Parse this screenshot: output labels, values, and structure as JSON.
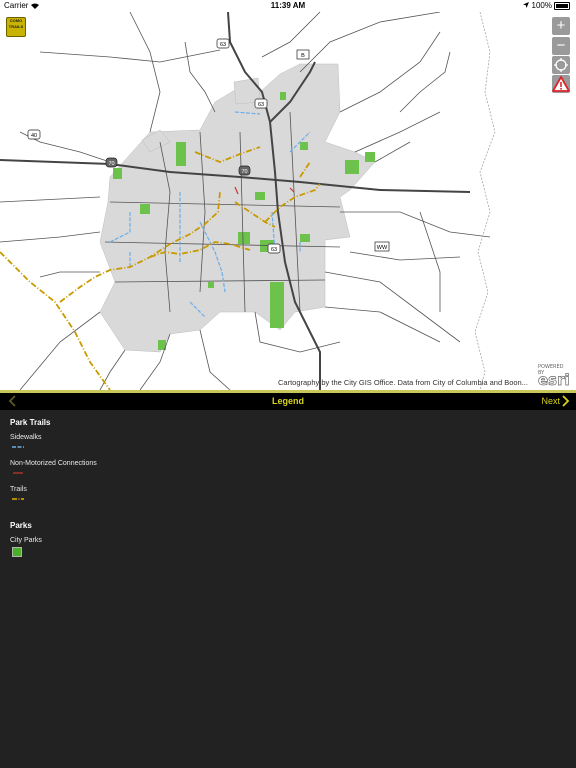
{
  "status_bar": {
    "carrier": "Carrier",
    "time": "11:39 AM",
    "battery": "100%"
  },
  "map": {
    "logo_text": "COMO TRAILS",
    "zoom_in": "+",
    "zoom_out": "−",
    "route_labels": [
      "63",
      "B",
      "63",
      "40",
      "70",
      "70",
      "63",
      "WW"
    ],
    "attribution": "Cartography by the City GIS Office. Data from City of Columbia and Boon...",
    "esri_powered": "POWERED BY",
    "esri_logo": "esri",
    "colors": {
      "city_area": "#d9d9d9",
      "parks": "#6cc24a",
      "sidewalks": "#6aaee8",
      "non_motorized": "#c0392b",
      "trails": "#c99a00",
      "roads": "#555555",
      "highways": "#444444"
    }
  },
  "legend_bar": {
    "title": "Legend",
    "next_label": "Next",
    "accent": "#d6d21c"
  },
  "legend": {
    "groups": [
      {
        "title": "Park Trails",
        "items": [
          {
            "label": "Sidewalks",
            "color": "#6aaee8"
          },
          {
            "label": "Non-Motorized Connections",
            "color": "#c0392b"
          },
          {
            "label": "Trails",
            "color": "#c99a00"
          }
        ]
      },
      {
        "title": "Parks",
        "items": [
          {
            "label": "City Parks",
            "color": "#4caf2a"
          }
        ]
      }
    ]
  }
}
